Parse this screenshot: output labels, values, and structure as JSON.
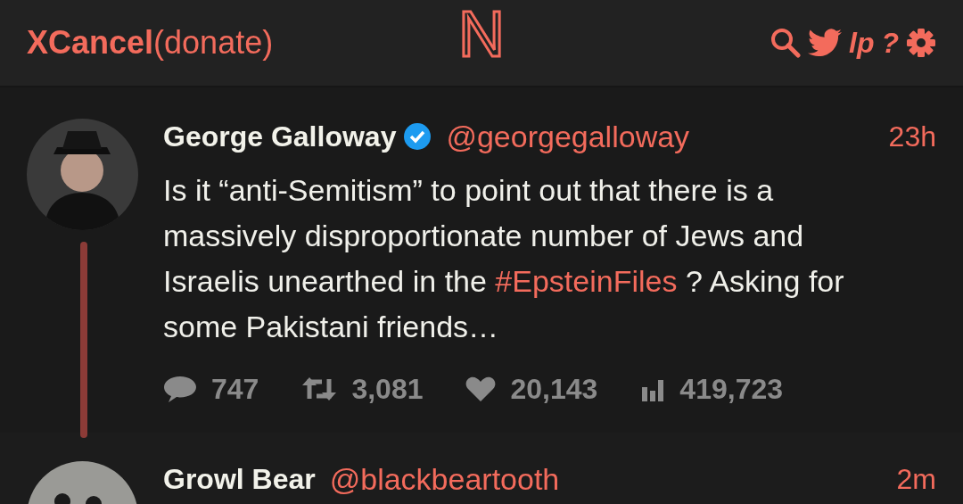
{
  "header": {
    "brand": "XCancel",
    "donate": "(donate)",
    "logo": "N",
    "icons": [
      {
        "kind": "search"
      },
      {
        "kind": "bird"
      },
      {
        "kind": "text",
        "label": "lp"
      },
      {
        "kind": "text",
        "label": "?"
      },
      {
        "kind": "gear"
      }
    ]
  },
  "tweets": [
    {
      "name": "George Galloway",
      "verified": true,
      "handle": "@georgegalloway",
      "time": "23h",
      "thread_line": true,
      "text": [
        {
          "kind": "plain",
          "text": "Is it “anti-Semitism” to point out that there is a massively disproportionate number of Jews and Israelis unearthed in the "
        },
        {
          "kind": "hashtag",
          "text": "#EpsteinFiles"
        },
        {
          "kind": "plain",
          "text": " ? Asking for some Pakistani friends…"
        }
      ],
      "stats": [
        {
          "kind": "reply",
          "value": "747"
        },
        {
          "kind": "retweet",
          "value": "3,081"
        },
        {
          "kind": "like",
          "value": "20,143"
        },
        {
          "kind": "views",
          "value": "419,723"
        }
      ]
    },
    {
      "name": "Growl Bear",
      "verified": false,
      "handle": "@blackbeartooth",
      "time": "2m",
      "thread_line": false
    }
  ]
}
